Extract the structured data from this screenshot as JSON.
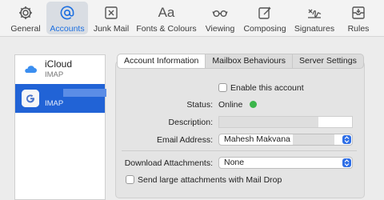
{
  "toolbar": {
    "items": [
      {
        "label": "General",
        "icon": "gear-icon"
      },
      {
        "label": "Accounts",
        "icon": "at-sign-icon"
      },
      {
        "label": "Junk Mail",
        "icon": "junk-tray-icon"
      },
      {
        "label": "Fonts & Colours",
        "icon": "font-aa-icon",
        "glyph": "Aa"
      },
      {
        "label": "Viewing",
        "icon": "glasses-icon"
      },
      {
        "label": "Composing",
        "icon": "compose-icon"
      },
      {
        "label": "Signatures",
        "icon": "signature-icon"
      },
      {
        "label": "Rules",
        "icon": "rules-envelope-icon"
      }
    ],
    "active": "Accounts"
  },
  "sidebar": {
    "accounts": [
      {
        "name": "iCloud",
        "type": "IMAP",
        "icon": "icloud-icon"
      },
      {
        "name": "",
        "type": "IMAP",
        "icon": "google-icon",
        "selected": true
      }
    ]
  },
  "tabs": [
    "Account Information",
    "Mailbox Behaviours",
    "Server Settings"
  ],
  "form": {
    "enable_label": "Enable this account",
    "status_label": "Status:",
    "status_value": "Online",
    "description_label": "Description:",
    "email_label": "Email Address:",
    "email_value": "Mahesh Makvana",
    "download_label": "Download Attachments:",
    "download_value": "None",
    "maildrop_label": "Send large attachments with Mail Drop"
  },
  "colors": {
    "accent": "#2163d6",
    "status_online": "#3bb54a"
  }
}
